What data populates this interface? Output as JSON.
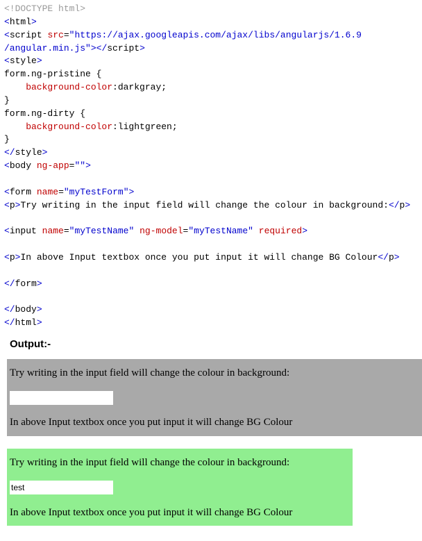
{
  "code": {
    "l01_doctype": "<!DOCTYPE html>",
    "l02_open": "<",
    "l02_tag": "html",
    "l02_close": ">",
    "l03_p1": "<",
    "l03_tag1": "script",
    "l03_attr1": "src",
    "l03_eq": "=",
    "l03_q": "\"",
    "l03_url1": "https://ajax.googleapis.com/ajax/libs/angularjs/1.6.9",
    "l03_url2": "/angular.min.js",
    "l03_gt": ">",
    "l03_ctag": "script",
    "l04_tag": "style",
    "l05_sel": "form.ng-pristine {",
    "l06_prop": "    background-color",
    "l06_val": ":darkgray;",
    "l07_close": "}",
    "l08_sel": "form.ng-dirty {",
    "l09_prop": "    background-color",
    "l09_val": ":lightgreen;",
    "l10_close": "}",
    "l11_tag": "style",
    "l12_tag": "body",
    "l12_attr": "ng-app",
    "l12_val": "\"\"",
    "l14_tag": "form",
    "l14_attr": "name",
    "l14_val": "\"myTestForm\"",
    "l15_tag": "p",
    "l15_txt": "Try writing in the input field will change the colour in background:",
    "l17_tag": "input",
    "l17_a1": "name",
    "l17_v1": "\"myTestName\"",
    "l17_a2": "ng-model",
    "l17_v2": "\"myTestName\"",
    "l17_a3": "required",
    "l19_tag": "p",
    "l19_txt": "In above Input textbox once you put input it will change BG Colour",
    "l21_tag": "form",
    "l23_tag": "body",
    "l24_tag": "html"
  },
  "output_label": "Output:-",
  "demo": {
    "p1": "Try writing in the input field will change the colour in background:",
    "p2": "In above Input textbox once you put input it will change BG Colour",
    "input_pristine": "",
    "input_dirty": "test"
  }
}
